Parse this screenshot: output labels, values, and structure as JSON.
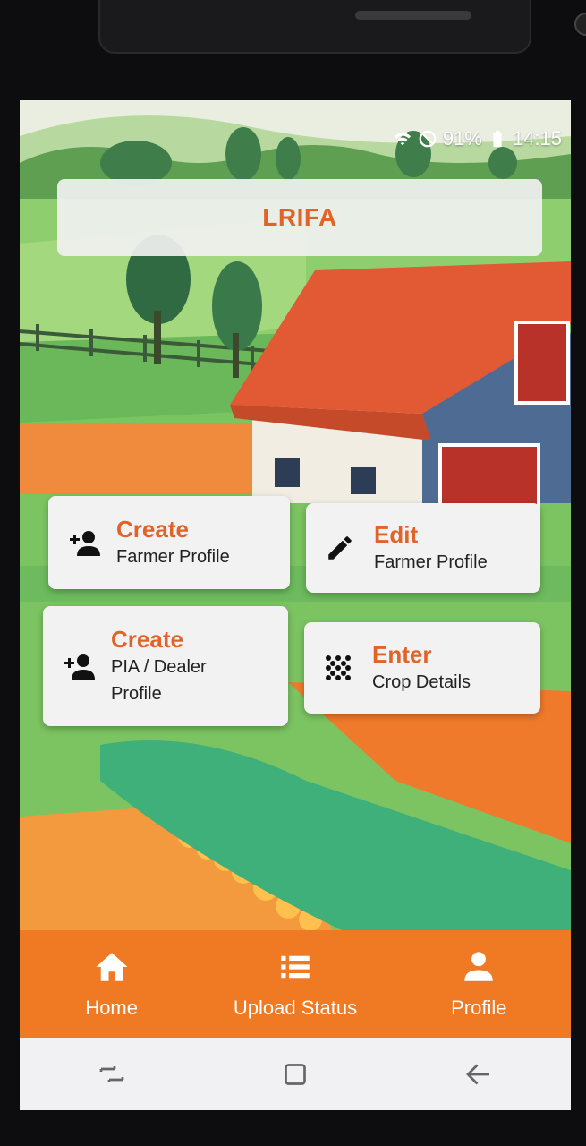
{
  "status_bar": {
    "battery": "91%",
    "time": "14:15"
  },
  "app": {
    "title": "LRIFA"
  },
  "actions": [
    {
      "title": "Create",
      "subtitle": "Farmer Profile",
      "icon": "add-person-icon"
    },
    {
      "title": "Edit",
      "subtitle": "Farmer Profile",
      "icon": "pencil-icon"
    },
    {
      "title": "Create",
      "subtitle": "PIA / Dealer Profile",
      "subtitle_line1": "PIA / Dealer",
      "subtitle_line2": "Profile",
      "icon": "add-person-icon"
    },
    {
      "title": "Enter",
      "subtitle": "Crop Details",
      "icon": "dots-grid-icon"
    }
  ],
  "nav": [
    {
      "label": "Home",
      "icon": "home-icon"
    },
    {
      "label": "Upload Status",
      "icon": "list-icon"
    },
    {
      "label": "Profile",
      "icon": "person-icon"
    }
  ],
  "system_nav": [
    "recents-icon",
    "home-square-icon",
    "back-icon"
  ],
  "colors": {
    "accent": "#e0642a",
    "navbar": "#f07a24",
    "card_bg": "#f2f2f3"
  }
}
